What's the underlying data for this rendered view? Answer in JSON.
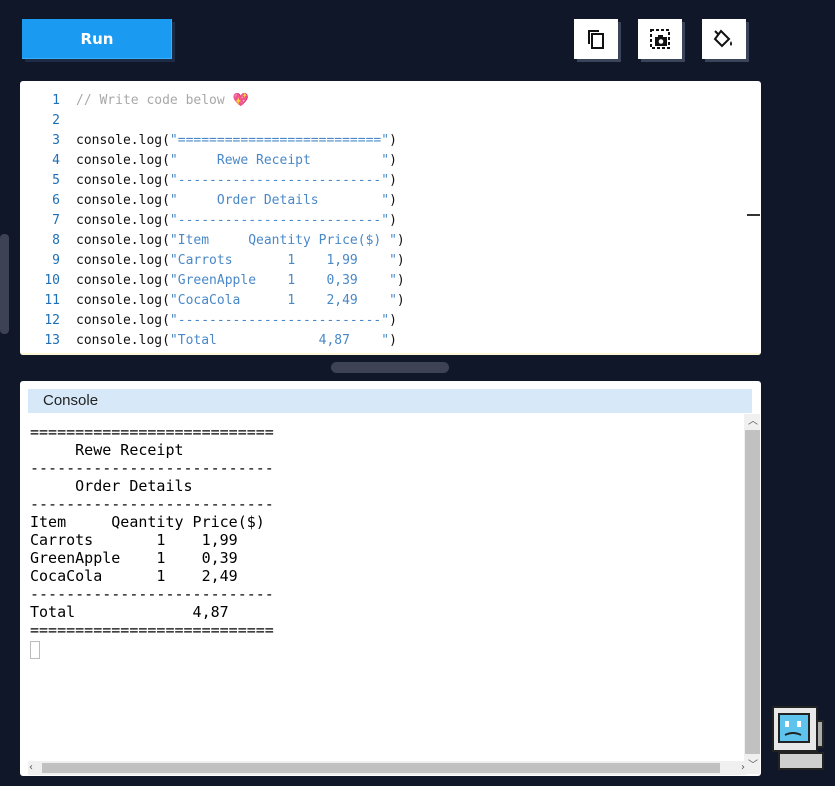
{
  "toolbar": {
    "run_label": "Run",
    "copy_icon": "copy-icon",
    "screenshot_icon": "screenshot-icon",
    "theme_icon": "paint-bucket-icon"
  },
  "editor": {
    "lines": [
      {
        "num": "1",
        "comment": "// Write code below 💖"
      },
      {
        "num": "2"
      },
      {
        "num": "3",
        "pre": "console.log(",
        "str": "\"==========================\"",
        "post": ")"
      },
      {
        "num": "4",
        "pre": "console.log(",
        "str": "\"     Rewe Receipt         \"",
        "post": ")"
      },
      {
        "num": "5",
        "pre": "console.log(",
        "str": "\"--------------------------\"",
        "post": ")"
      },
      {
        "num": "6",
        "pre": "console.log(",
        "str": "\"     Order Details        \"",
        "post": ")"
      },
      {
        "num": "7",
        "pre": "console.log(",
        "str": "\"--------------------------\"",
        "post": ")"
      },
      {
        "num": "8",
        "pre": "console.log(",
        "str": "\"Item     Qeantity Price($) \"",
        "post": ")"
      },
      {
        "num": "9",
        "pre": "console.log(",
        "str": "\"Carrots       1    1,99    \"",
        "post": ")"
      },
      {
        "num": "10",
        "pre": "console.log(",
        "str": "\"GreenApple    1    0,39    \"",
        "post": ")"
      },
      {
        "num": "11",
        "pre": "console.log(",
        "str": "\"CocaCola      1    2,49    \"",
        "post": ")"
      },
      {
        "num": "12",
        "pre": "console.log(",
        "str": "\"--------------------------\"",
        "post": ")"
      },
      {
        "num": "13",
        "pre": "console.log(",
        "str": "\"Total             4,87    \"",
        "post": ")"
      }
    ]
  },
  "console": {
    "title": "Console",
    "output": [
      "===========================",
      "     Rewe Receipt",
      "---------------------------",
      "     Order Details",
      "---------------------------",
      "Item     Qeantity Price($)",
      "Carrots       1    1,99",
      "GreenApple    1    0,39",
      "CocaCola      1    2,49",
      "---------------------------",
      "Total             4,87",
      "==========================="
    ]
  },
  "mascot_icon": "retro-computer-icon"
}
